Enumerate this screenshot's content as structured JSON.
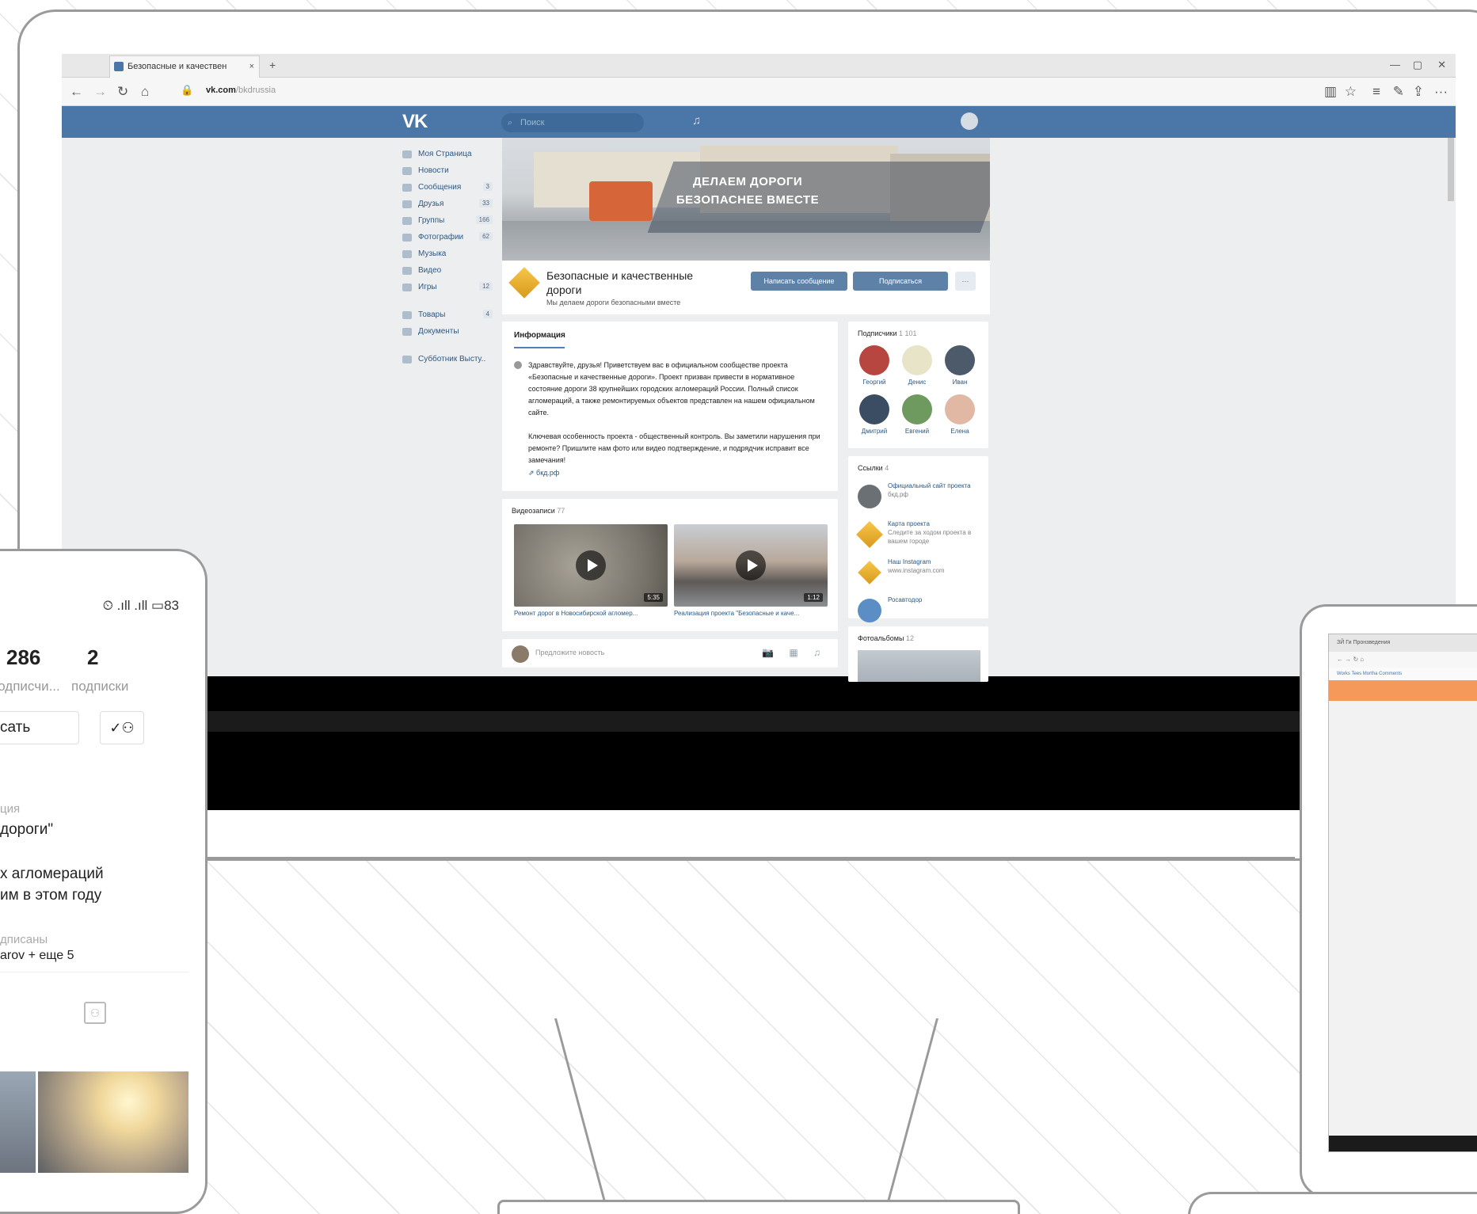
{
  "browser": {
    "tab_title": "Безопасные и качествен",
    "tab_close": "×",
    "new_tab": "+",
    "url_host": "vk.com",
    "url_path": "/bkdrussia"
  },
  "vk": {
    "logo": "VK",
    "search_placeholder": "Поиск",
    "left_nav": [
      {
        "label": "Моя Страница",
        "count": ""
      },
      {
        "label": "Новости",
        "count": ""
      },
      {
        "label": "Сообщения",
        "count": "3"
      },
      {
        "label": "Друзья",
        "count": "33"
      },
      {
        "label": "Группы",
        "count": "166"
      },
      {
        "label": "Фотографии",
        "count": "62"
      },
      {
        "label": "Музыка",
        "count": ""
      },
      {
        "label": "Видео",
        "count": ""
      },
      {
        "label": "Игры",
        "count": "12"
      },
      {
        "label": "Товары",
        "count": "4"
      },
      {
        "label": "Документы",
        "count": ""
      },
      {
        "label": "Субботник Выстy..",
        "count": ""
      }
    ],
    "cover_title_line1": "ДЕЛАЕМ ДОРОГИ",
    "cover_title_line2": "БЕЗОПАСНЕЕ ВМЕСТЕ",
    "group_name": "Безопасные и качественные дороги",
    "group_status": "Мы делаем дороги безопасными вместе",
    "write_button": "Написать сообщение",
    "subscribe_button": "Подписаться",
    "more_button": "···",
    "info": {
      "heading": "Информация",
      "para1": "Здравствуйте, друзья! Приветствуем вас в официальном сообществе проекта «Безопасные и качественные дороги». Проект призван привести в нормативное состояние дороги 38 крупнейших городских агломераций России. Полный список агломераций, а также ремонтируемых объектов представлен на нашем официальном сайте.",
      "para2": "Ключевая особенность проекта - общественный контроль. Вы заметили нарушения при ремонте? Пришлите нам фото или видео подтверждение, и подрядчик исправит все замечания!",
      "link": "бкд.рф"
    },
    "subscribers": {
      "heading": "Подписчики",
      "count": "1 101",
      "people": [
        "Георгий",
        "Денис",
        "Иван",
        "Дмитрий",
        "Евгений",
        "Елена"
      ]
    },
    "links": {
      "heading": "Ссылки",
      "count": "4",
      "items": [
        {
          "title": "Официальный сайт проекта",
          "sub": "бкд.рф"
        },
        {
          "title": "Карта проекта",
          "sub": "Следите за ходом проекта в вашем городе"
        },
        {
          "title": "Наш Instagram",
          "sub": "www.instagram.com"
        },
        {
          "title": "Росавтодор",
          "sub": ""
        }
      ]
    },
    "photos": {
      "heading": "Фотоальбомы",
      "count": "12"
    },
    "videos": {
      "heading": "Видеозаписи",
      "count": "77",
      "items": [
        {
          "caption": "Ремонт дорог в Новосибирской агломер...",
          "duration": "5:35"
        },
        {
          "caption": "Реализация проекта \"Безопасные и каче...",
          "duration": "1:12"
        }
      ]
    },
    "post_placeholder": "Предложите новость",
    "post_icons": "📷 ▦ ♫"
  },
  "phone": {
    "status_icons": "⏲ .ıll .ıll ▭83",
    "followers_count": "286",
    "followers_label": "подписчи...",
    "following_count": "2",
    "following_label": "подписки",
    "message_button": "сать",
    "follow_icon": "✓⚇",
    "section_label": "ция",
    "line1": "дороги\"",
    "line2": "х агломераций",
    "line3": "им в этом году",
    "subscribed_label": "дписаны",
    "subscribed_names": "arov + еще 5"
  },
  "tablet": {
    "tab_title": "ЗЙ Ги Пронзведения",
    "nav_links": "Works  Tees  Mortha  Comments"
  }
}
